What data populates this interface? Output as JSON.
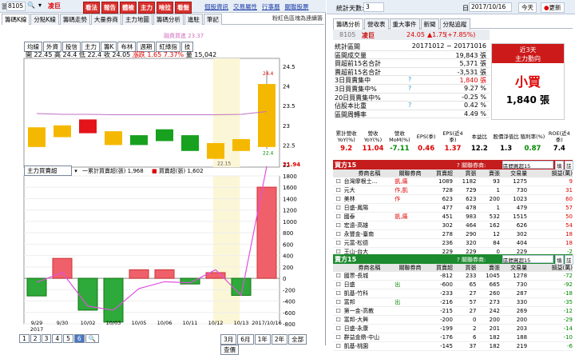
{
  "left": {
    "side_label": "籌",
    "stock_code": "8105",
    "stock_name": "凌巨",
    "red_buttons": [
      "看法",
      "報告",
      "體檢",
      "主力",
      "啥拉",
      "看盤"
    ],
    "links": [
      "個股資訊",
      "交易屬性",
      "行事曆",
      "關聯股票"
    ],
    "tabs": [
      "籌碼K線",
      "分點K線",
      "籌碼走勢",
      "大量券商",
      "主力地圖",
      "籌碼分析",
      "進駐",
      "筆記"
    ],
    "tab_note": "粉紅色區塊為連續籌",
    "indicator_chips": [
      "均線",
      "外資",
      "投信",
      "主力",
      "籌K",
      "布林",
      "週期",
      "紅綠指",
      "技"
    ],
    "price_overlay": "融資買進 23.37",
    "ohlc_prefix": "開",
    "ohlc": {
      "open": "22.45",
      "high_label": "高",
      "high": "24.4",
      "low_label": "低",
      "low": "22.4",
      "close_label": "收",
      "close": "24.05",
      "change_label": "漲跌",
      "change": "1.65",
      "change_pct": "7.37%",
      "volume_label": "量",
      "volume": "15,042"
    },
    "price_axis": [
      "24.5",
      "24",
      "23.5",
      "23",
      "22.5",
      "22"
    ],
    "price_marker": "21.94",
    "top_label": "24.4",
    "bottom_label": "22.4",
    "low_box": "22.15",
    "lower_select": "主力買賣超",
    "lower_legend1": "一累計買賣超(張) 1,968",
    "lower_legend2": "買賣超(張) 1,602",
    "vol_axis": [
      "1800",
      "1600",
      "1400",
      "1200",
      "1000",
      "800",
      "600",
      "400",
      "200",
      "0",
      "-200",
      "-400",
      "-600",
      "-800"
    ],
    "dates": [
      "9/29",
      "9/30",
      "10/02",
      "10/03",
      "10/05",
      "10/06",
      "10/11",
      "10/12",
      "10/13",
      "2017/10/16"
    ],
    "year": "2017",
    "pages": [
      "1",
      "2",
      "3",
      "4",
      "5",
      "6"
    ],
    "period_buttons": [
      "3月",
      "6月",
      "1年",
      "2年",
      "全部",
      "查價"
    ]
  },
  "right": {
    "stat_label": "統計天數:",
    "stat_value": "3",
    "date_label": "日期:",
    "date_value": "2017/10/16",
    "today": "今天",
    "refresh": "更新",
    "tabs": [
      "籌碼分析",
      "營收表",
      "重大事件",
      "新聞",
      "分點追蹤"
    ],
    "code": "8105",
    "name": "凌巨",
    "price": "24.05",
    "chg": "▲1.75",
    "pct": "(+7.85%)",
    "stats": [
      {
        "label": "統計區間",
        "value": "20171012 ~ 20171016"
      },
      {
        "label": "區間成交量",
        "value": "19,843 張"
      },
      {
        "label": "買超前15名合計",
        "value": "5,371 張"
      },
      {
        "label": "賣超前15名合計",
        "value": "-3,531 張"
      },
      {
        "label": "3日買賣集中",
        "value": "1,840 張",
        "q": "?"
      },
      {
        "label": "3日買賣集中%",
        "value": "9.27 %",
        "q": "?"
      },
      {
        "label": "20日買賣集中%",
        "value": "-0.25 %"
      },
      {
        "label": "佔股本比重",
        "value": "0.42 %",
        "q": "?"
      },
      {
        "label": "區間周轉率",
        "value": "4.49 %"
      }
    ],
    "box_title": "近3天",
    "box_sub": "主力動向",
    "buy_label": "小買",
    "buy_amt": "1,840 張",
    "ind_headers": [
      "累計營收YoY(%)",
      "營收YoY(%)",
      "營收MoM(%)",
      "EPS(季)",
      "EPS(近4季)",
      "本益比",
      "股價淨值比",
      "殖利率(%)",
      "ROE(近4季)"
    ],
    "ind_values": [
      "9.2",
      "11.04",
      "-7.11",
      "0.46",
      "1.37",
      "12.2",
      "1.3",
      "0.87",
      "7.4"
    ],
    "buy_title": "買方15",
    "sell_title": "賣方15",
    "assoc_label": "關聯券商:",
    "assoc_value": "區間買超15",
    "assoc_btn1": "填",
    "assoc_btn2": "註",
    "cols": [
      "券商名稱",
      "關聯券商",
      "買賣超",
      "買張",
      "賣張",
      "交易量",
      "損益(萬)"
    ],
    "buy_rows": [
      [
        "台灣摩根士...",
        "凱,痛",
        "1089",
        "1182",
        "93",
        "1275",
        "9"
      ],
      [
        "元大",
        "作,凱",
        "728",
        "729",
        "1",
        "730",
        "31"
      ],
      [
        "美林",
        "作",
        "623",
        "623",
        "200",
        "1023",
        "60"
      ],
      [
        "日盛-鳳陽",
        "",
        "477",
        "478",
        "1",
        "479",
        "57"
      ],
      [
        "國泰",
        "凱,痛",
        "451",
        "983",
        "532",
        "1515",
        "50"
      ],
      [
        "宏遠-高雄",
        "",
        "302",
        "464",
        "162",
        "626",
        "54"
      ],
      [
        "永豐金-臺南",
        "",
        "278",
        "290",
        "12",
        "302",
        "18"
      ],
      [
        "元富-松德",
        "",
        "236",
        "320",
        "84",
        "404",
        "18"
      ],
      [
        "王山-台大",
        "",
        "229",
        "229",
        "0",
        "229",
        "-2"
      ]
    ],
    "sell_rows": [
      [
        "國票-長城",
        "",
        "-812",
        "233",
        "1045",
        "1278",
        "-72"
      ],
      [
        "日盛",
        "出",
        "-600",
        "65",
        "665",
        "730",
        "-92"
      ],
      [
        "凱基-竹科",
        "",
        "-233",
        "27",
        "260",
        "287",
        "-18"
      ],
      [
        "富邦",
        "出",
        "-216",
        "57",
        "273",
        "330",
        "-35"
      ],
      [
        "第一金-高教",
        "",
        "-215",
        "27",
        "242",
        "269",
        "-12"
      ],
      [
        "富邦-大興",
        "",
        "-200",
        "0",
        "200",
        "200",
        "-29"
      ],
      [
        "日盛-永康",
        "",
        "-199",
        "2",
        "201",
        "203",
        "-14"
      ],
      [
        "群益金鼎-中山",
        "",
        "-176",
        "6",
        "182",
        "188",
        "-10"
      ],
      [
        "凱基-桃園",
        "",
        "-145",
        "37",
        "182",
        "219",
        "-6"
      ]
    ]
  },
  "chart_data": [
    {
      "type": "candlestick",
      "title": "",
      "categories": [
        "9/29",
        "9/30",
        "10/02",
        "10/03",
        "10/05",
        "10/06",
        "10/11",
        "10/12",
        "10/13",
        "2017/10/16"
      ],
      "candles": [
        {
          "o": 22.95,
          "c": 22.45,
          "h": 22.95,
          "l": 22.45,
          "color": "gold"
        },
        {
          "o": 23.0,
          "c": 22.7,
          "h": 23.0,
          "l": 22.7,
          "color": "gold"
        },
        {
          "o": 23.15,
          "c": 22.8,
          "h": 23.15,
          "l": 22.8,
          "color": "red"
        },
        {
          "o": 22.85,
          "c": 22.5,
          "h": 22.85,
          "l": 22.5,
          "color": "gold"
        },
        {
          "o": 22.75,
          "c": 22.5,
          "h": 22.75,
          "l": 22.5,
          "color": "green"
        },
        {
          "o": 22.9,
          "c": 22.6,
          "h": 22.9,
          "l": 22.6,
          "color": "green"
        },
        {
          "o": 22.75,
          "c": 22.35,
          "h": 22.75,
          "l": 22.35,
          "color": "green"
        },
        {
          "o": 22.55,
          "c": 22.15,
          "h": 22.55,
          "l": 22.15,
          "color": "gold"
        },
        {
          "o": 22.65,
          "c": 22.35,
          "h": 22.65,
          "l": 22.35,
          "color": "gold"
        },
        {
          "o": 22.45,
          "c": 24.05,
          "h": 24.4,
          "l": 22.4,
          "color": "gold"
        }
      ],
      "ma": [
        23.3,
        23.28,
        23.28,
        23.27,
        23.27,
        23.27,
        23.27,
        23.27,
        23.28,
        23.35
      ],
      "ylim": [
        21.94,
        24.7
      ]
    },
    {
      "type": "bar",
      "title": "",
      "categories": [
        "9/29",
        "9/30",
        "10/02",
        "10/03",
        "10/05",
        "10/06",
        "10/11",
        "10/12",
        "10/13",
        "2017/10/16"
      ],
      "series": [
        {
          "name": "買賣超(張)",
          "values": [
            -310,
            350,
            -560,
            -770,
            150,
            150,
            -100,
            100,
            -300,
            1602
          ]
        },
        {
          "name": "累計買賣超(張)",
          "values": [
            -70,
            100,
            -490,
            -560,
            -180,
            -60,
            -80,
            150,
            -300,
            1968
          ]
        }
      ],
      "ylim": [
        -800,
        1800
      ]
    }
  ]
}
